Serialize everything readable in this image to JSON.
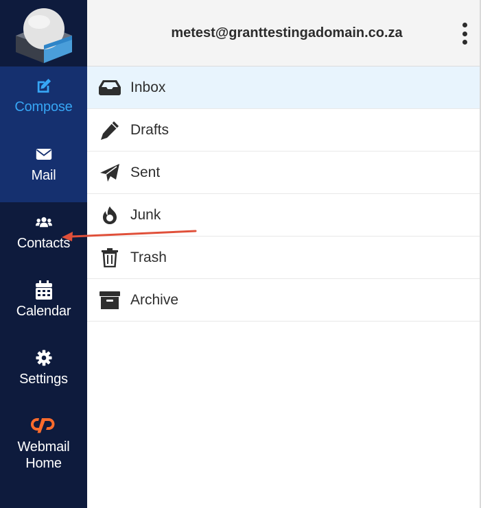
{
  "header": {
    "account": "metest@granttestingadomain.co.za"
  },
  "sidebar": {
    "items": [
      {
        "label": "Compose"
      },
      {
        "label": "Mail"
      },
      {
        "label": "Contacts"
      },
      {
        "label": "Calendar"
      },
      {
        "label": "Settings"
      },
      {
        "label": "Webmail\nHome"
      }
    ]
  },
  "folders": [
    {
      "name": "Inbox"
    },
    {
      "name": "Drafts"
    },
    {
      "name": "Sent"
    },
    {
      "name": "Junk"
    },
    {
      "name": "Trash"
    },
    {
      "name": "Archive"
    }
  ],
  "colors": {
    "sidebar_bg": "#0e1b3d",
    "sidebar_active_bg": "#15306f",
    "compose_accent": "#37a6f5",
    "cpanel_orange": "#ff6c2c",
    "selected_row": "#e8f4fd",
    "annotation_arrow": "#e0503a"
  }
}
